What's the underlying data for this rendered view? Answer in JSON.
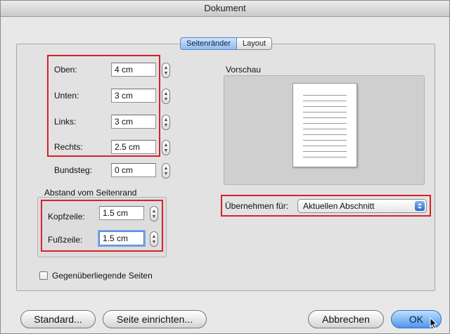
{
  "window": {
    "title": "Dokument"
  },
  "tabs": [
    {
      "label": "Seitenränder"
    },
    {
      "label": "Layout"
    }
  ],
  "margins": {
    "top": {
      "label": "Oben:",
      "value": "4 cm"
    },
    "bottom": {
      "label": "Unten:",
      "value": "3 cm"
    },
    "left": {
      "label": "Links:",
      "value": "3 cm"
    },
    "right": {
      "label": "Rechts:",
      "value": "2.5 cm"
    },
    "gutter": {
      "label": "Bundsteg:",
      "value": "0 cm"
    }
  },
  "edge_distance": {
    "title": "Abstand vom Seitenrand",
    "header": {
      "label": "Kopfzeile:",
      "value": "1.5 cm"
    },
    "footer": {
      "label": "Fußzeile:",
      "value": "1.5 cm"
    }
  },
  "preview": {
    "label": "Vorschau"
  },
  "apply": {
    "label": "Übernehmen für:",
    "selected": "Aktuellen Abschnitt"
  },
  "mirror_margins": {
    "label": "Gegenüberliegende Seiten",
    "checked": false
  },
  "buttons": {
    "default_label": "Standard...",
    "page_setup_label": "Seite einrichten...",
    "cancel_label": "Abbrechen",
    "ok_label": "OK"
  },
  "colors": {
    "annotation_red": "#d6222a",
    "accent_blue": "#4f95ee"
  }
}
